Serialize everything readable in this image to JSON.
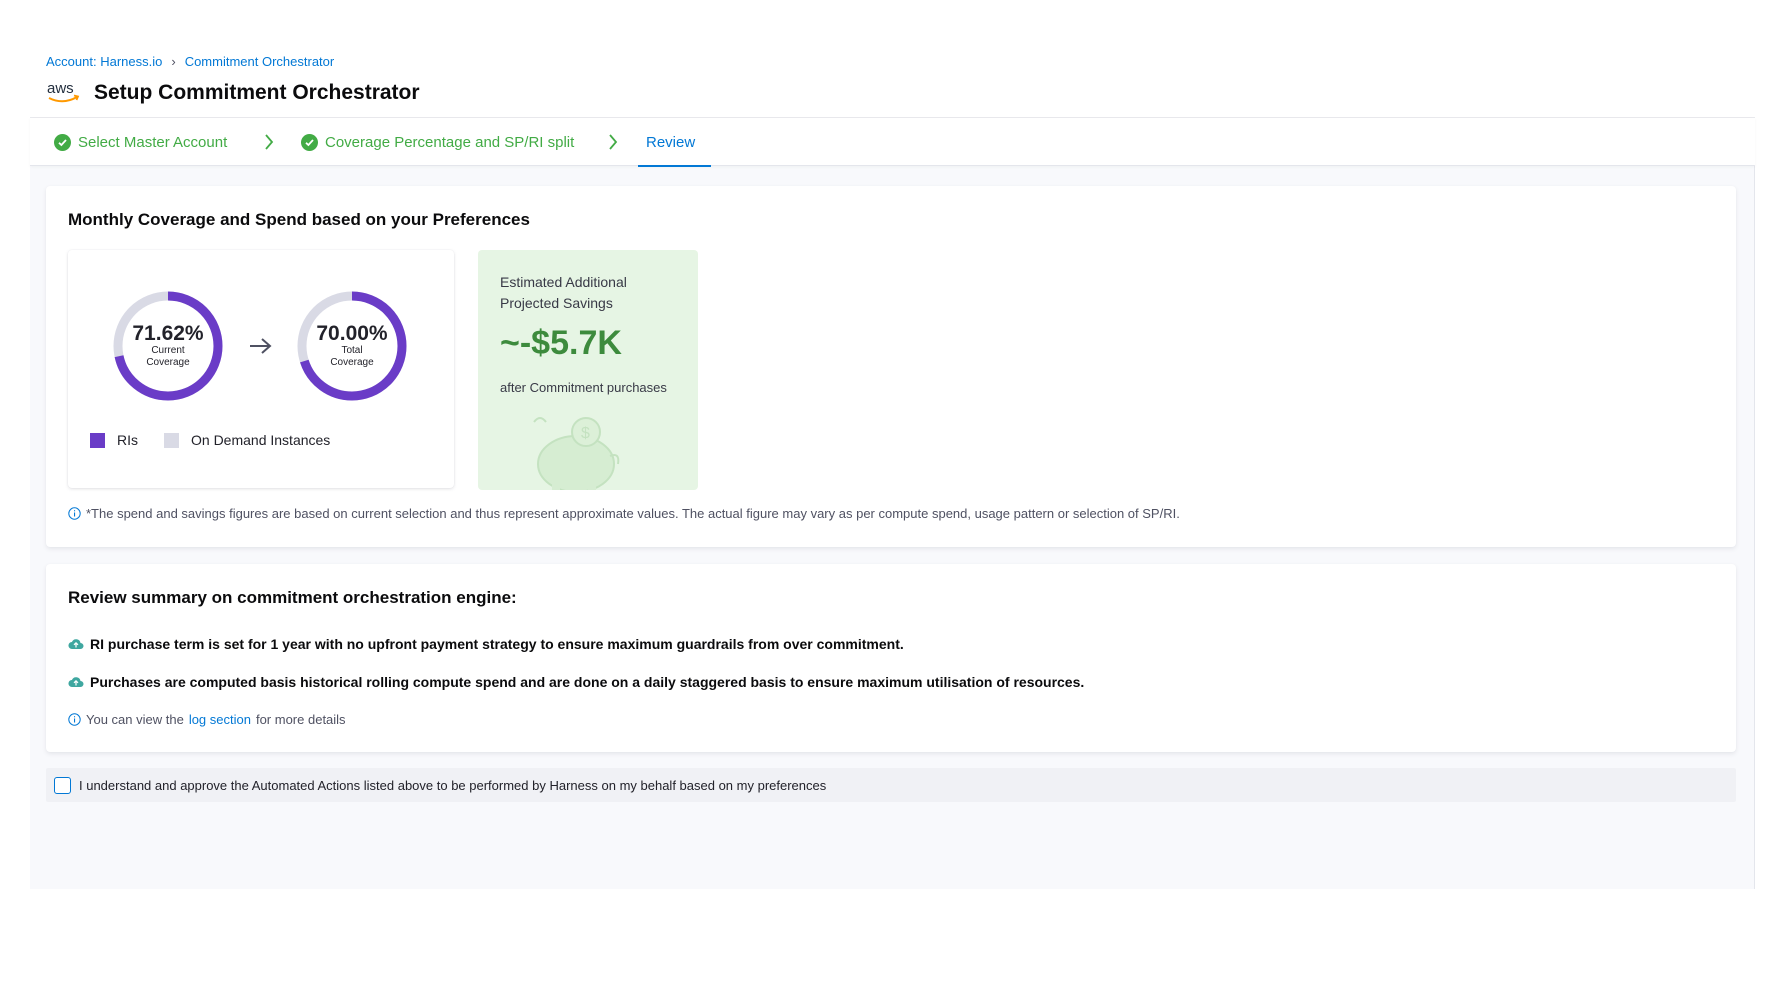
{
  "breadcrumb": {
    "account": "Account: Harness.io",
    "page": "Commitment Orchestrator"
  },
  "header": {
    "logo_text": "aws",
    "title": "Setup Commitment Orchestrator"
  },
  "tabs": [
    {
      "label": "Select Master Account",
      "state": "done"
    },
    {
      "label": "Coverage Percentage and SP/RI split",
      "state": "done"
    },
    {
      "label": "Review",
      "state": "active"
    }
  ],
  "coverage_card": {
    "title": "Monthly Coverage and Spend based on your Preferences",
    "current": {
      "value": 71.62,
      "label_pct": "71.62%",
      "label": "Current Coverage"
    },
    "total": {
      "value": 70.0,
      "label_pct": "70.00%",
      "label": "Total Coverage"
    },
    "legend": [
      {
        "label": "RIs",
        "color": "#6a3cc7"
      },
      {
        "label": "On Demand Instances",
        "color": "#d9dae5"
      }
    ],
    "savings": {
      "label": "Estimated Additional Projected Savings",
      "value": "~-$5.7K",
      "sub": "after Commitment purchases"
    },
    "note": "*The spend and savings figures are based on current selection and thus represent approximate values. The actual figure may vary as per compute spend, usage pattern or selection of SP/RI."
  },
  "summary_card": {
    "title": "Review summary on commitment orchestration engine:",
    "lines": [
      "RI purchase term is set for 1 year with no upfront payment strategy to ensure maximum guardrails from over commitment.",
      "Purchases are computed basis historical rolling compute spend and are done on a daily staggered basis to ensure maximum utilisation of resources."
    ],
    "log_note_prefix": "You can view the",
    "log_link": "log section",
    "log_note_suffix": "for more details"
  },
  "approval": {
    "label": "I understand and approve the Automated Actions listed above to be performed by Harness on my behalf based on my preferences",
    "checked": false
  },
  "colors": {
    "accent": "#0278d5",
    "success": "#42ab45",
    "ri_purple": "#6a3cc7",
    "on_demand_grey": "#d9dae5",
    "savings_green": "#3d8b3d"
  }
}
